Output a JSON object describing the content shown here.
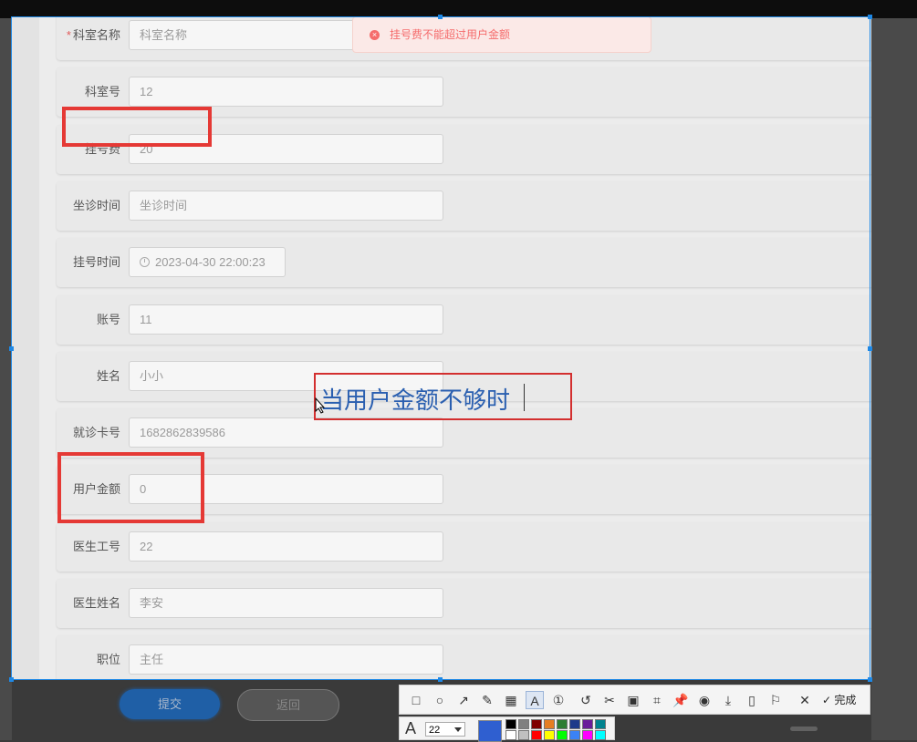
{
  "toast": {
    "message": "挂号费不能超过用户金额",
    "icon": "error-circle-icon"
  },
  "form": {
    "fields": [
      {
        "label": "科室名称",
        "required": true,
        "value": "科室名称",
        "is_placeholder": true
      },
      {
        "label": "科室号",
        "value": "12"
      },
      {
        "label": "挂号费",
        "value": "20"
      },
      {
        "label": "坐诊时间",
        "value": "坐诊时间",
        "is_placeholder": true
      },
      {
        "label": "挂号时间",
        "value": "2023-04-30 22:00:23",
        "type": "datetime"
      },
      {
        "label": "账号",
        "value": "11"
      },
      {
        "label": "姓名",
        "value": "小小"
      },
      {
        "label": "就诊卡号",
        "value": "1682862839586"
      },
      {
        "label": "用户金额",
        "value": "0"
      },
      {
        "label": "医生工号",
        "value": "22"
      },
      {
        "label": "医生姓名",
        "value": "李安"
      },
      {
        "label": "职位",
        "value": "主任"
      }
    ],
    "required_mark": "*"
  },
  "buttons": {
    "submit": "提交",
    "back": "返回"
  },
  "annotation": {
    "text": "当用户金额不够时",
    "color": "#2a5fb0",
    "box_color": "#d32f2f"
  },
  "screenshot_toolbar": {
    "tools": [
      "rectangle-icon",
      "ellipse-icon",
      "arrow-icon",
      "pen-icon",
      "mosaic-icon",
      "text-icon",
      "number-icon",
      "undo-icon",
      "cut-icon",
      "ocr-icon",
      "pin-icon",
      "pushpin-icon",
      "record-icon",
      "download-icon",
      "phone-icon",
      "bookmark-icon",
      "close-icon"
    ],
    "done_label": "完成",
    "font_size": "22",
    "current_color": "#2f5fd0",
    "palette": [
      "#000000",
      "#808080",
      "#800000",
      "#e67e22",
      "#2e7d32",
      "#1e3a8a",
      "#6a1b9a",
      "#00838f",
      "#ffffff",
      "#c0c0c0",
      "#ff0000",
      "#ffff00",
      "#00ff00",
      "#3b82f6",
      "#ff00ff",
      "#00ffff"
    ]
  },
  "colors": {
    "highlight": "#e53935",
    "selection": "#1e88e5",
    "toast_text": "#f56c6c"
  }
}
